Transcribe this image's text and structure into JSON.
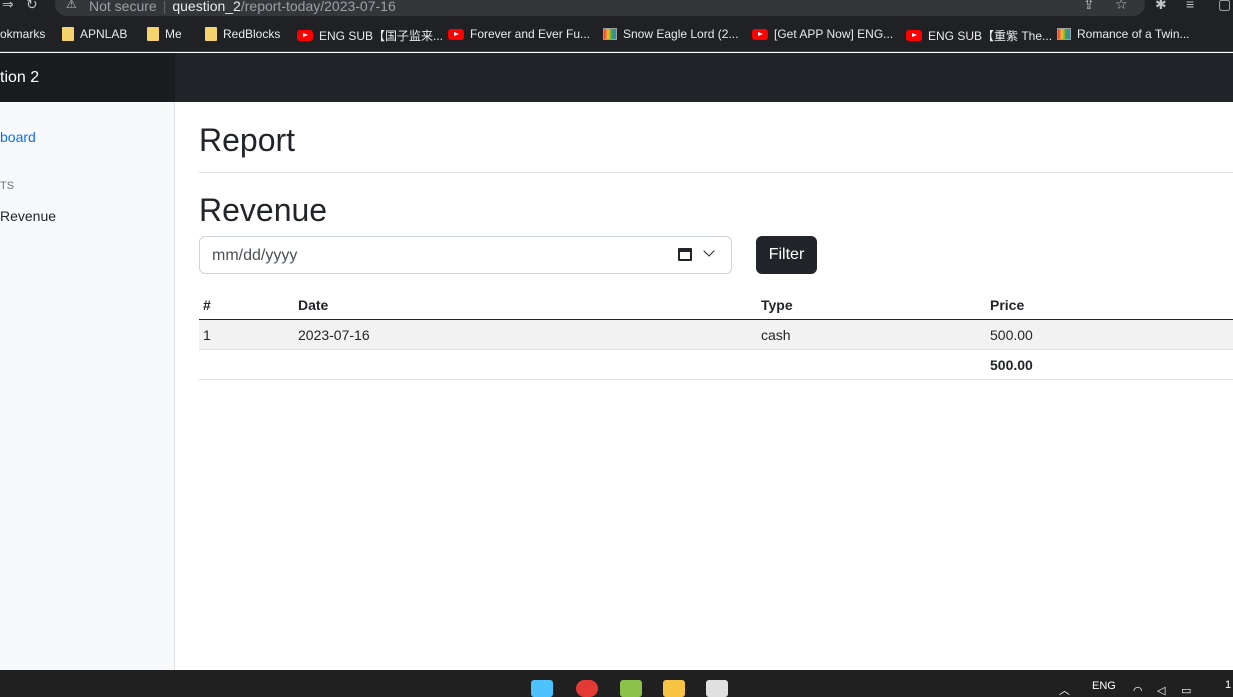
{
  "browser": {
    "security_label": "Not secure",
    "url_host": "question_2",
    "url_path": "/report-today/2023-07-16",
    "bookmarks": [
      {
        "label": "okmarks",
        "icon": "folder-icon"
      },
      {
        "label": "APNLAB",
        "icon": "folder-icon"
      },
      {
        "label": "Me",
        "icon": "folder-icon"
      },
      {
        "label": "RedBlocks",
        "icon": "folder-icon"
      },
      {
        "label": "ENG SUB【国子监来...",
        "icon": "youtube-icon"
      },
      {
        "label": "Forever and Ever Fu...",
        "icon": "youtube-icon"
      },
      {
        "label": "Snow Eagle Lord (2...",
        "icon": "tv-icon"
      },
      {
        "label": "[Get APP Now] ENG...",
        "icon": "youtube-icon"
      },
      {
        "label": "ENG SUB【重紫 The...",
        "icon": "youtube-icon"
      },
      {
        "label": "Romance of a Twin...",
        "icon": "tv-icon"
      }
    ]
  },
  "app": {
    "brand": "tion 2"
  },
  "sidebar": {
    "dashboard_label": "board",
    "section_label": "TS",
    "revenue_label": "Revenue"
  },
  "main": {
    "page_title": "Report",
    "section_title": "Revenue",
    "date_placeholder": "mm/dd/yyyy",
    "filter_label": "Filter"
  },
  "table": {
    "headers": [
      "#",
      "Date",
      "Type",
      "Price"
    ],
    "rows": [
      [
        "1",
        "2023-07-16",
        "cash",
        "500.00"
      ]
    ],
    "total": "500.00"
  },
  "taskbar": {
    "language": "ENG",
    "clock_partial": "1"
  },
  "colors": {
    "navbar": "#212529",
    "link": "#0d6efd",
    "button": "#212529"
  }
}
